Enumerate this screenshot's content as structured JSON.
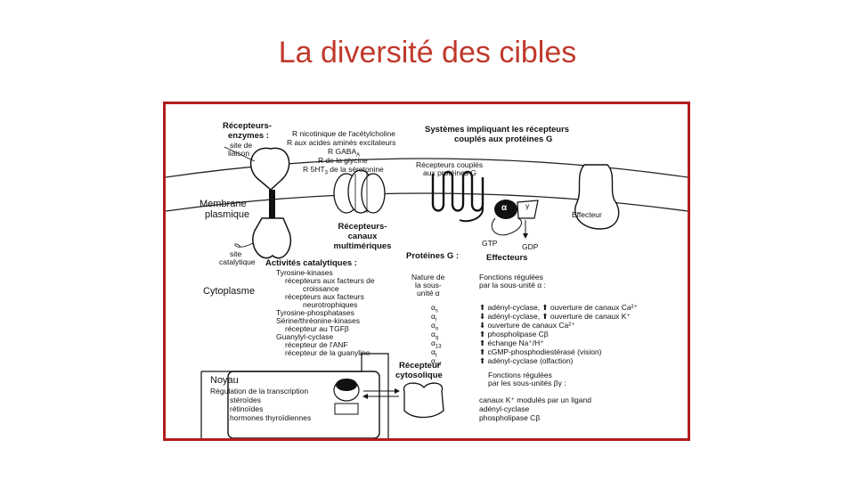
{
  "slide": {
    "title": "La diversité des cibles"
  },
  "enzymes": {
    "title_l1": "Récepteurs-",
    "title_l2": "enzymes :",
    "site_liaison_l1": "site de",
    "site_liaison_l2": "liaison",
    "site_catalytique_l1": "site",
    "site_catalytique_l2": "catalytique"
  },
  "canaux_list": [
    "R nicotinique de l'acétylcholine",
    "R aux acides aminés excitateurs",
    "R GABA",
    "R de la glycine",
    "R 5HT",
    "de la sérotonine"
  ],
  "canaux_subscripts": {
    "gaba": "A",
    "ht": "3"
  },
  "canaux": {
    "title_l1": "Récepteurs-",
    "title_l2": "canaux",
    "title_l3": "multimériques"
  },
  "systemes": {
    "title_l1": "Systèmes impliquant les récepteurs",
    "title_l2": "couplés aux protéines G",
    "couples_l1": "Récepteurs couplés",
    "couples_l2": "aux protéines G",
    "alpha": "α",
    "gamma": "γ",
    "effecteur": "Effecteur",
    "gtp": "GTP",
    "gdp": "GDP"
  },
  "membrane": {
    "l1": "Membrane",
    "l2": "plasmique"
  },
  "cytoplasme": "Cytoplasme",
  "activites": {
    "title": "Activités catalytiques :",
    "lines": [
      "Tyrosine-kinases",
      "récepteurs aux facteurs de",
      "croissance",
      "récepteurs aux facteurs",
      "neurotrophiques",
      "Tyrosine-phosphatases",
      "Sérine/thréonine-kinases",
      "récepteur au TGFβ",
      "Guanylyl-cyclase",
      "récepteur de l'ANF",
      "récepteur de la guanyline"
    ]
  },
  "proteines_g": {
    "title": "Protéines G :",
    "nature_l1": "Nature de",
    "nature_l2": "la sous-",
    "nature_l3": "unité α",
    "alpha_list": [
      "α",
      "α",
      "α",
      "α",
      "α",
      "α",
      "α"
    ],
    "alpha_sub": [
      "s",
      "i",
      "o",
      "q",
      "13",
      "t",
      "olf"
    ]
  },
  "effecteurs": {
    "title": "Effecteurs",
    "fonctions_l1": "Fonctions régulées",
    "fonctions_l2": "par la sous-unité α :",
    "alpha_lines": [
      "⬆ adényl-cyclase, ⬆ ouverture de canaux Ca²⁺",
      "⬇ adényl-cyclase, ⬆ ouverture de canaux K⁺",
      "⬇ ouverture de canaux Ca²⁺",
      "⬆ phospholipase Cβ",
      "⬆ échange Na⁺/H⁺",
      "⬆ cGMP-phosphodiestérasé (vision)",
      "⬆ adényl-cyclase (olfaction)"
    ],
    "bg_l1": "Fonctions régulées",
    "bg_l2": "par les sous-unités βγ :",
    "bg_lines": [
      "canaux K⁺ modulés par un ligand",
      "adényl-cyclase",
      "phospholipase Cβ"
    ]
  },
  "noyau": {
    "title": "Noyau",
    "lines": [
      "Régulation de la transcription",
      "stéroïdes",
      "rétinoïdes",
      "hormones thyroïdiennes"
    ]
  },
  "cytosolique": {
    "l1": "Récepteur",
    "l2": "cytosolique"
  }
}
